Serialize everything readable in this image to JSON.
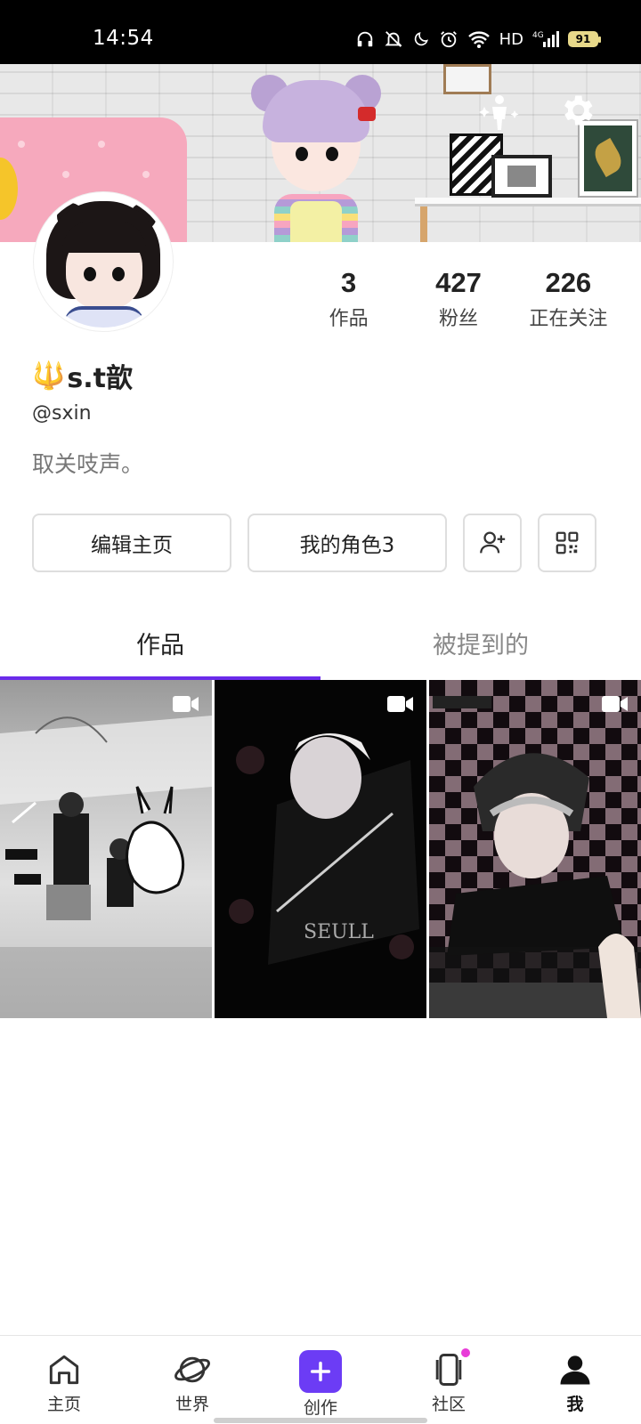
{
  "status_bar": {
    "time": "14:54",
    "network": "HD",
    "signal": "4G",
    "battery": "91"
  },
  "profile": {
    "name": "s.t歆",
    "name_emoji": "🔱",
    "handle": "@sxin",
    "bio": "取关吱声。"
  },
  "stats": [
    {
      "value": "3",
      "label": "作品"
    },
    {
      "value": "427",
      "label": "粉丝"
    },
    {
      "value": "226",
      "label": "正在关注"
    }
  ],
  "actions": {
    "edit_label": "编辑主页",
    "roles_label": "我的角色3",
    "add_friend_icon": "add-person-icon",
    "qr_icon": "qr-code-icon"
  },
  "tabs": [
    {
      "label": "作品",
      "active": true
    },
    {
      "label": "被提到的",
      "active": false
    }
  ],
  "accent_color": "#6a2bea",
  "bottom_nav": [
    {
      "label": "主页",
      "icon": "home-icon"
    },
    {
      "label": "世界",
      "icon": "planet-icon"
    },
    {
      "label": "创作",
      "icon": "plus-icon"
    },
    {
      "label": "社区",
      "icon": "cards-icon"
    },
    {
      "label": "我",
      "icon": "person-icon"
    }
  ]
}
